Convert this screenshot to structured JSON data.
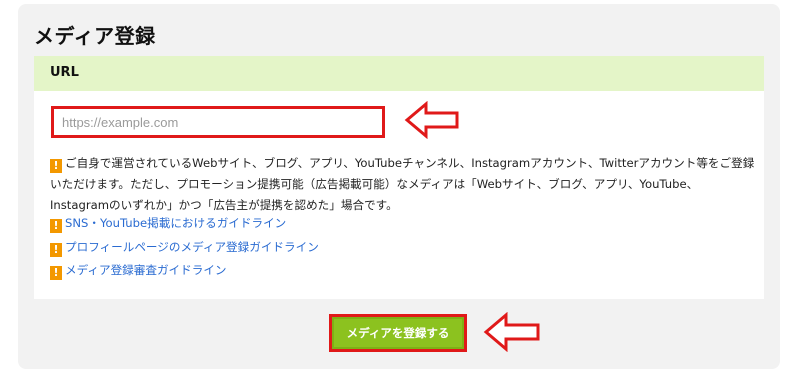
{
  "page": {
    "title": "メディア登録"
  },
  "url_section": {
    "label": "URL",
    "input": {
      "placeholder": "https://example.com",
      "value": ""
    },
    "notice": "ご自身で運営されているWebサイト、ブログ、アプリ、YouTubeチャンネル、Instagramアカウント、Twitterアカウント等をご登録いただけます。ただし、プロモーション提携可能（広告掲載可能）なメディアは「Webサイト、ブログ、アプリ、YouTube、Instagramのいずれか」かつ「広告主が提携を認めた」場合です。",
    "links": [
      {
        "label": "SNS・YouTube掲載におけるガイドライン"
      },
      {
        "label": "プロフィールページのメディア登録ガイドライン"
      },
      {
        "label": "メディア登録審査ガイドライン"
      }
    ]
  },
  "actions": {
    "submit_label": "メディアを登録する"
  },
  "icons": {
    "warning": "warning-icon",
    "annotation_arrow": "left-arrow-icon"
  },
  "colors": {
    "accent_green": "#8cc21f",
    "section_header_bg": "#e4f5c8",
    "highlight_red": "#e01919",
    "warning_orange": "#f39800",
    "link_blue": "#2a6bd1"
  }
}
